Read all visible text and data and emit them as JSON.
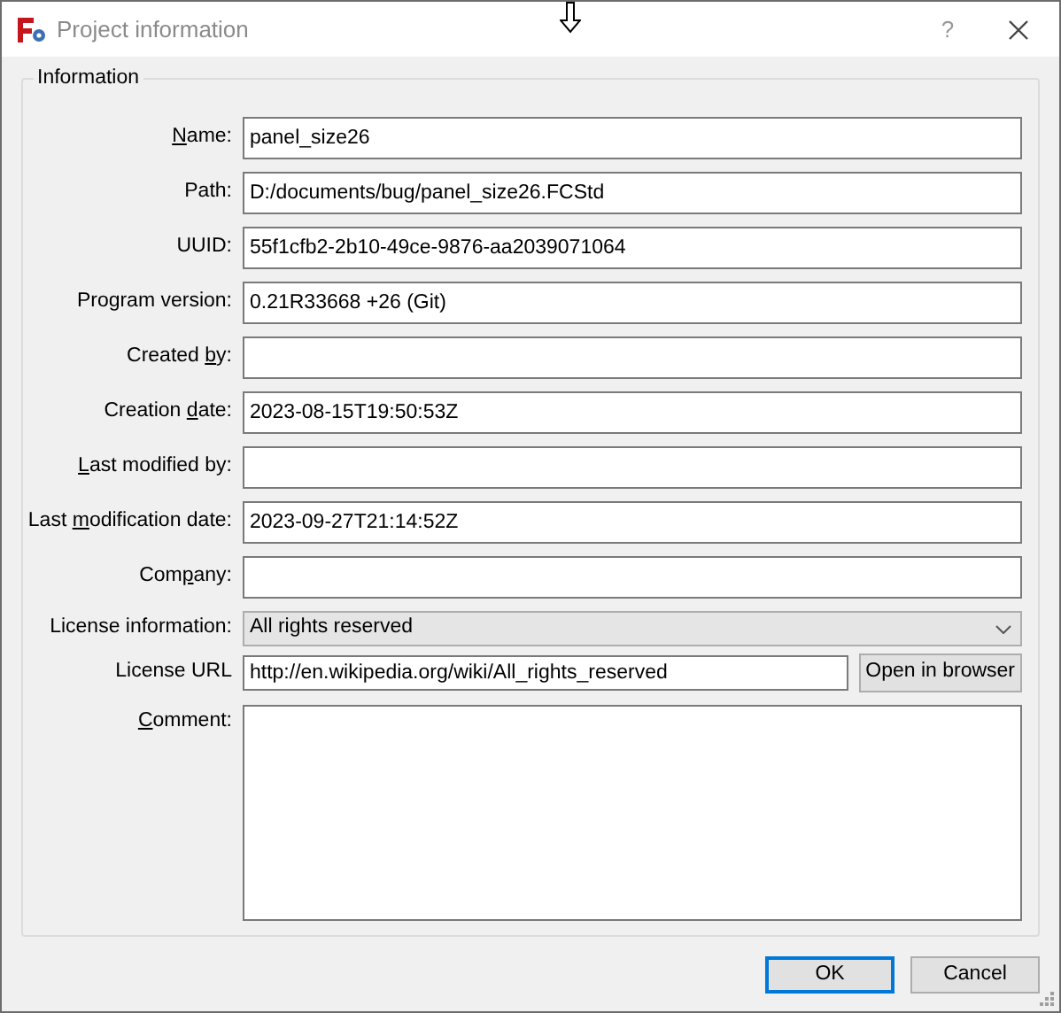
{
  "window": {
    "title": "Project information",
    "help": "?"
  },
  "group": {
    "title": "Information"
  },
  "fields": [
    {
      "kind": "text",
      "label": [
        {
          "text": "N",
          "underline": true
        },
        {
          "text": "ame:",
          "underline": false
        }
      ],
      "value": "panel_size26"
    },
    {
      "kind": "text",
      "label": [
        {
          "text": "Path:",
          "underline": false
        }
      ],
      "value": "D:/documents/bug/panel_size26.FCStd"
    },
    {
      "kind": "text",
      "label": [
        {
          "text": "UUID:",
          "underline": false
        }
      ],
      "value": "55f1cfb2-2b10-49ce-9876-aa2039071064"
    },
    {
      "kind": "text",
      "label": [
        {
          "text": "Program version:",
          "underline": false
        }
      ],
      "value": "0.21R33668 +26 (Git)"
    },
    {
      "kind": "text",
      "label": [
        {
          "text": "Created ",
          "underline": false
        },
        {
          "text": "b",
          "underline": true
        },
        {
          "text": "y:",
          "underline": false
        }
      ]
    },
    {
      "kind": "text",
      "label": [
        {
          "text": "Creation ",
          "underline": false
        },
        {
          "text": "d",
          "underline": true
        },
        {
          "text": "ate:",
          "underline": false
        }
      ],
      "value": "2023-08-15T19:50:53Z"
    },
    {
      "kind": "text",
      "label": [
        {
          "text": "L",
          "underline": true
        },
        {
          "text": "ast modified by:",
          "underline": false
        }
      ]
    },
    {
      "kind": "text",
      "label": [
        {
          "text": "Last ",
          "underline": false
        },
        {
          "text": "m",
          "underline": true
        },
        {
          "text": "odification date:",
          "underline": false
        }
      ],
      "value": "2023-09-27T21:14:52Z"
    },
    {
      "kind": "text",
      "label": [
        {
          "text": "Com",
          "underline": false
        },
        {
          "text": "p",
          "underline": true
        },
        {
          "text": "any:",
          "underline": false
        }
      ]
    },
    {
      "kind": "combo",
      "label": [
        {
          "text": "License information:",
          "underline": false
        }
      ],
      "value": "All rights reserved"
    },
    {
      "kind": "url",
      "label": [
        {
          "text": "License URL",
          "underline": false
        }
      ],
      "value": "http://en.wikipedia.org/wiki/All_rights_reserved",
      "button": "Open in browser"
    },
    {
      "kind": "area",
      "label": [
        {
          "text": "C",
          "underline": true
        },
        {
          "text": "omment:",
          "underline": false
        }
      ]
    }
  ],
  "buttons": [
    {
      "label": "OK",
      "default": true
    },
    {
      "label": "Cancel",
      "default": false
    }
  ]
}
